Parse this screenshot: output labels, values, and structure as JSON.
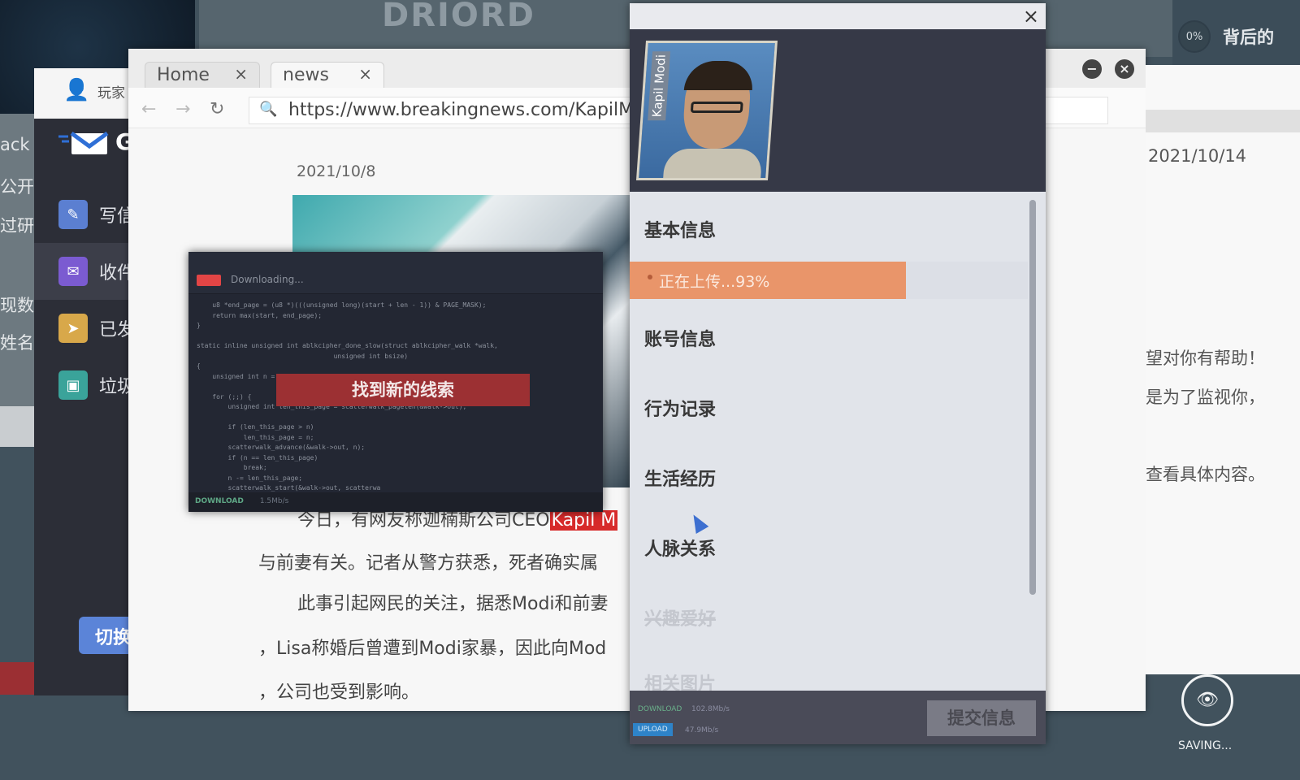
{
  "background": {
    "logo_text": "DRIORD",
    "top_right_percent": "0%",
    "top_right_text": "背后的"
  },
  "left_window": {
    "lines": [
      "ack",
      "公开",
      "过研",
      "现数",
      "姓名"
    ]
  },
  "mail": {
    "user_label": "玩家",
    "logo_initial": "G",
    "items": [
      {
        "label": "写信",
        "icon": "edit-icon",
        "color": "#5b7fd1"
      },
      {
        "label": "收件",
        "icon": "envelope-icon",
        "color": "#7b5bd1"
      },
      {
        "label": "已发",
        "icon": "send-icon",
        "color": "#d8a84a"
      },
      {
        "label": "垃圾",
        "icon": "trash-icon",
        "color": "#3aa39a"
      }
    ],
    "switch_label": "切换"
  },
  "browser": {
    "tabs": [
      {
        "label": "Home",
        "close": "×"
      },
      {
        "label": "news",
        "close": "×"
      }
    ],
    "url": "https://www.breakingnews.com/KapilModi",
    "article": {
      "date": "2021/10/8",
      "lines": [
        "今日，有网友称迦楠斯公司CEO",
        "与前妻有关。记者从警方获悉，死者确实属",
        "此事引起网民的关注，据悉Modi和前妻",
        "，Lisa称婚后曾遭到Modi家暴，因此向Mod",
        "，公司也受到影响。"
      ],
      "highlight": "Kapil M"
    }
  },
  "right_window": {
    "date": "2021/10/14",
    "lines": [
      "望对你有帮助！",
      "是为了监视你，",
      "查看具体内容。"
    ]
  },
  "downloader": {
    "title": "Downloading...",
    "code": "    u8 *end_page = (u8 *)(((unsigned long)(start + len - 1)) &amp; PAGE_MASK);\n    return max(start, end_page);\n}\n\nstatic inline unsigned int ablkcipher_done_slow(struct ablkcipher_walk *walk,\n                                   unsigned int bsize)\n{\n    unsigned int n = bsize;\n\n    for (;;) {\n        unsigned int len_this_page = scatterwalk_pagelen(&amp;walk-&gt;out);\n\n        if (len_this_page &gt; n)\n            len_this_page = n;\n        scatterwalk_advance(&amp;walk-&gt;out, n);\n        if (n == len_this_page)\n            break;\n        n -= len_this_page;\n        scatterwalk_start(&amp;walk-&gt;out, scatterwa",
    "notice": "找到新的线索",
    "footer_label": "DOWNLOAD",
    "footer_speed": "1.5Mb/s"
  },
  "profile": {
    "close": "×",
    "portrait_name": "Kapil Modi",
    "items": [
      "基本信息",
      "账号信息",
      "行为记录",
      "生活经历",
      "人脉关系",
      "兴趣爱好",
      "相关图片"
    ],
    "upload": {
      "label": "正在上传...93%",
      "percent": 93,
      "color": "#e9956a"
    },
    "footer": {
      "download_label": "DOWNLOAD",
      "download_speed": "102.8Mb/s",
      "upload_label": "UPLOAD",
      "upload_speed": "47.9Mb/s",
      "submit": "提交信息"
    }
  },
  "saving": {
    "label": "SAVING..."
  }
}
